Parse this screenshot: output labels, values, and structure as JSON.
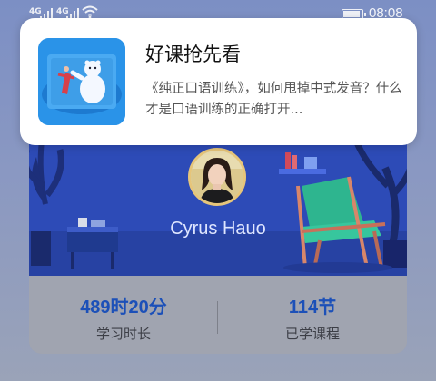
{
  "status_bar": {
    "signal_1": "4G",
    "signal_2": "4G",
    "time": "08:08",
    "battery_level": 0.9,
    "icons": [
      "signal-icon",
      "signal-icon",
      "wifi-icon",
      "battery-icon"
    ]
  },
  "notification": {
    "title": "好课抢先看",
    "body": "《纯正口语训练》，如何甩掉中式发音？什么才是口语训练的正确打开...",
    "thumbnail_icon": "polar-bear-course-icon"
  },
  "profile": {
    "username": "Cyrus Hauo",
    "stats": [
      {
        "value": "489时20分",
        "label": "学习时长"
      },
      {
        "value": "114节",
        "label": "已学课程"
      }
    ]
  },
  "colors": {
    "banner": "#2d4bb7",
    "accent": "#1c50b8",
    "notification_bg": "#ffffff"
  }
}
